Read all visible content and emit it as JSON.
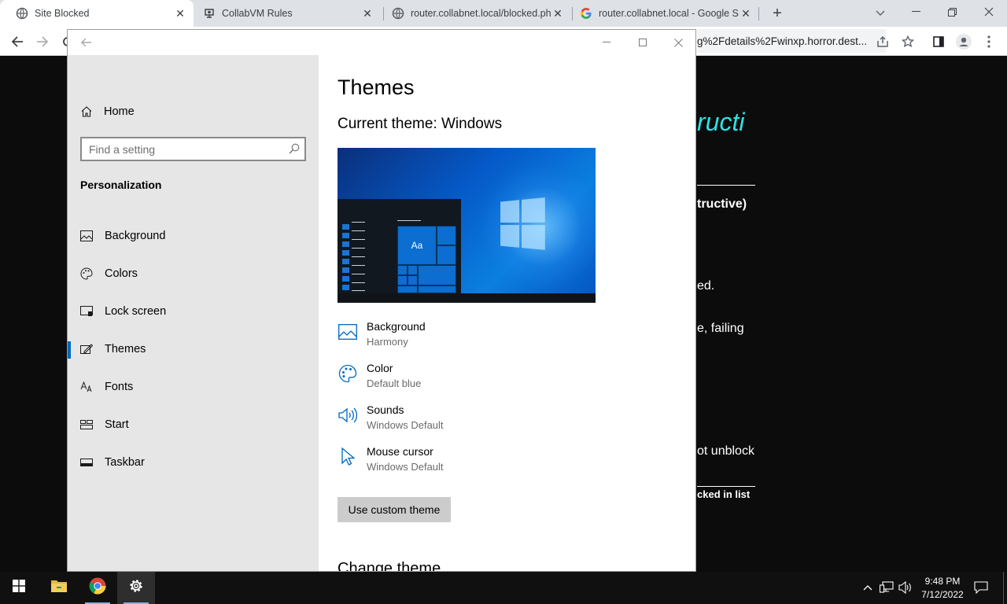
{
  "browser": {
    "tabs": [
      {
        "title": "Site Blocked",
        "icon": "globe-icon",
        "active": true
      },
      {
        "title": "CollabVM Rules",
        "icon": "collabvm-icon",
        "active": false
      },
      {
        "title": "router.collabnet.local/blocked.ph",
        "icon": "globe-icon",
        "active": false
      },
      {
        "title": "router.collabnet.local - Google Sc",
        "icon": "google-icon",
        "active": false
      }
    ],
    "new_tab_glyph": "+",
    "tab_search_glyph": "⌄",
    "address": "g%2Fdetails%2Fwinxp.horror.dest..."
  },
  "webpage": {
    "heading": "ructi",
    "line1": "tructive)",
    "line2": "ed.",
    "line3": "e, failing",
    "line4": "ot unblock",
    "line5": "cked in list"
  },
  "settings": {
    "nav": {
      "home_label": "Home",
      "search_placeholder": "Find a setting",
      "section_title": "Personalization",
      "items": [
        {
          "label": "Background",
          "icon": "picture-icon"
        },
        {
          "label": "Colors",
          "icon": "palette-icon"
        },
        {
          "label": "Lock screen",
          "icon": "lock-screen-icon"
        },
        {
          "label": "Themes",
          "icon": "themes-icon",
          "selected": true
        },
        {
          "label": "Fonts",
          "icon": "fonts-icon"
        },
        {
          "label": "Start",
          "icon": "start-icon"
        },
        {
          "label": "Taskbar",
          "icon": "taskbar-icon"
        }
      ]
    },
    "content": {
      "page_title": "Themes",
      "current_theme": "Current theme: Windows",
      "preview_tile_label": "Aa",
      "properties": [
        {
          "name": "Background",
          "value": "Harmony",
          "icon": "picture-icon"
        },
        {
          "name": "Color",
          "value": "Default blue",
          "icon": "palette-icon"
        },
        {
          "name": "Sounds",
          "value": "Windows Default",
          "icon": "speaker-icon"
        },
        {
          "name": "Mouse cursor",
          "value": "Windows Default",
          "icon": "cursor-icon"
        }
      ],
      "custom_theme_button": "Use custom theme",
      "change_theme_heading": "Change theme"
    }
  },
  "taskbar": {
    "clock_time": "9:48 PM",
    "clock_date": "7/12/2022",
    "pinned": [
      {
        "name": "File Explorer",
        "icon": "folder-icon"
      },
      {
        "name": "Google Chrome",
        "icon": "chrome-icon"
      },
      {
        "name": "Settings",
        "icon": "gear-icon"
      }
    ]
  },
  "colors": {
    "accent": "#0067c0",
    "web_heading": "#2de2e6"
  }
}
